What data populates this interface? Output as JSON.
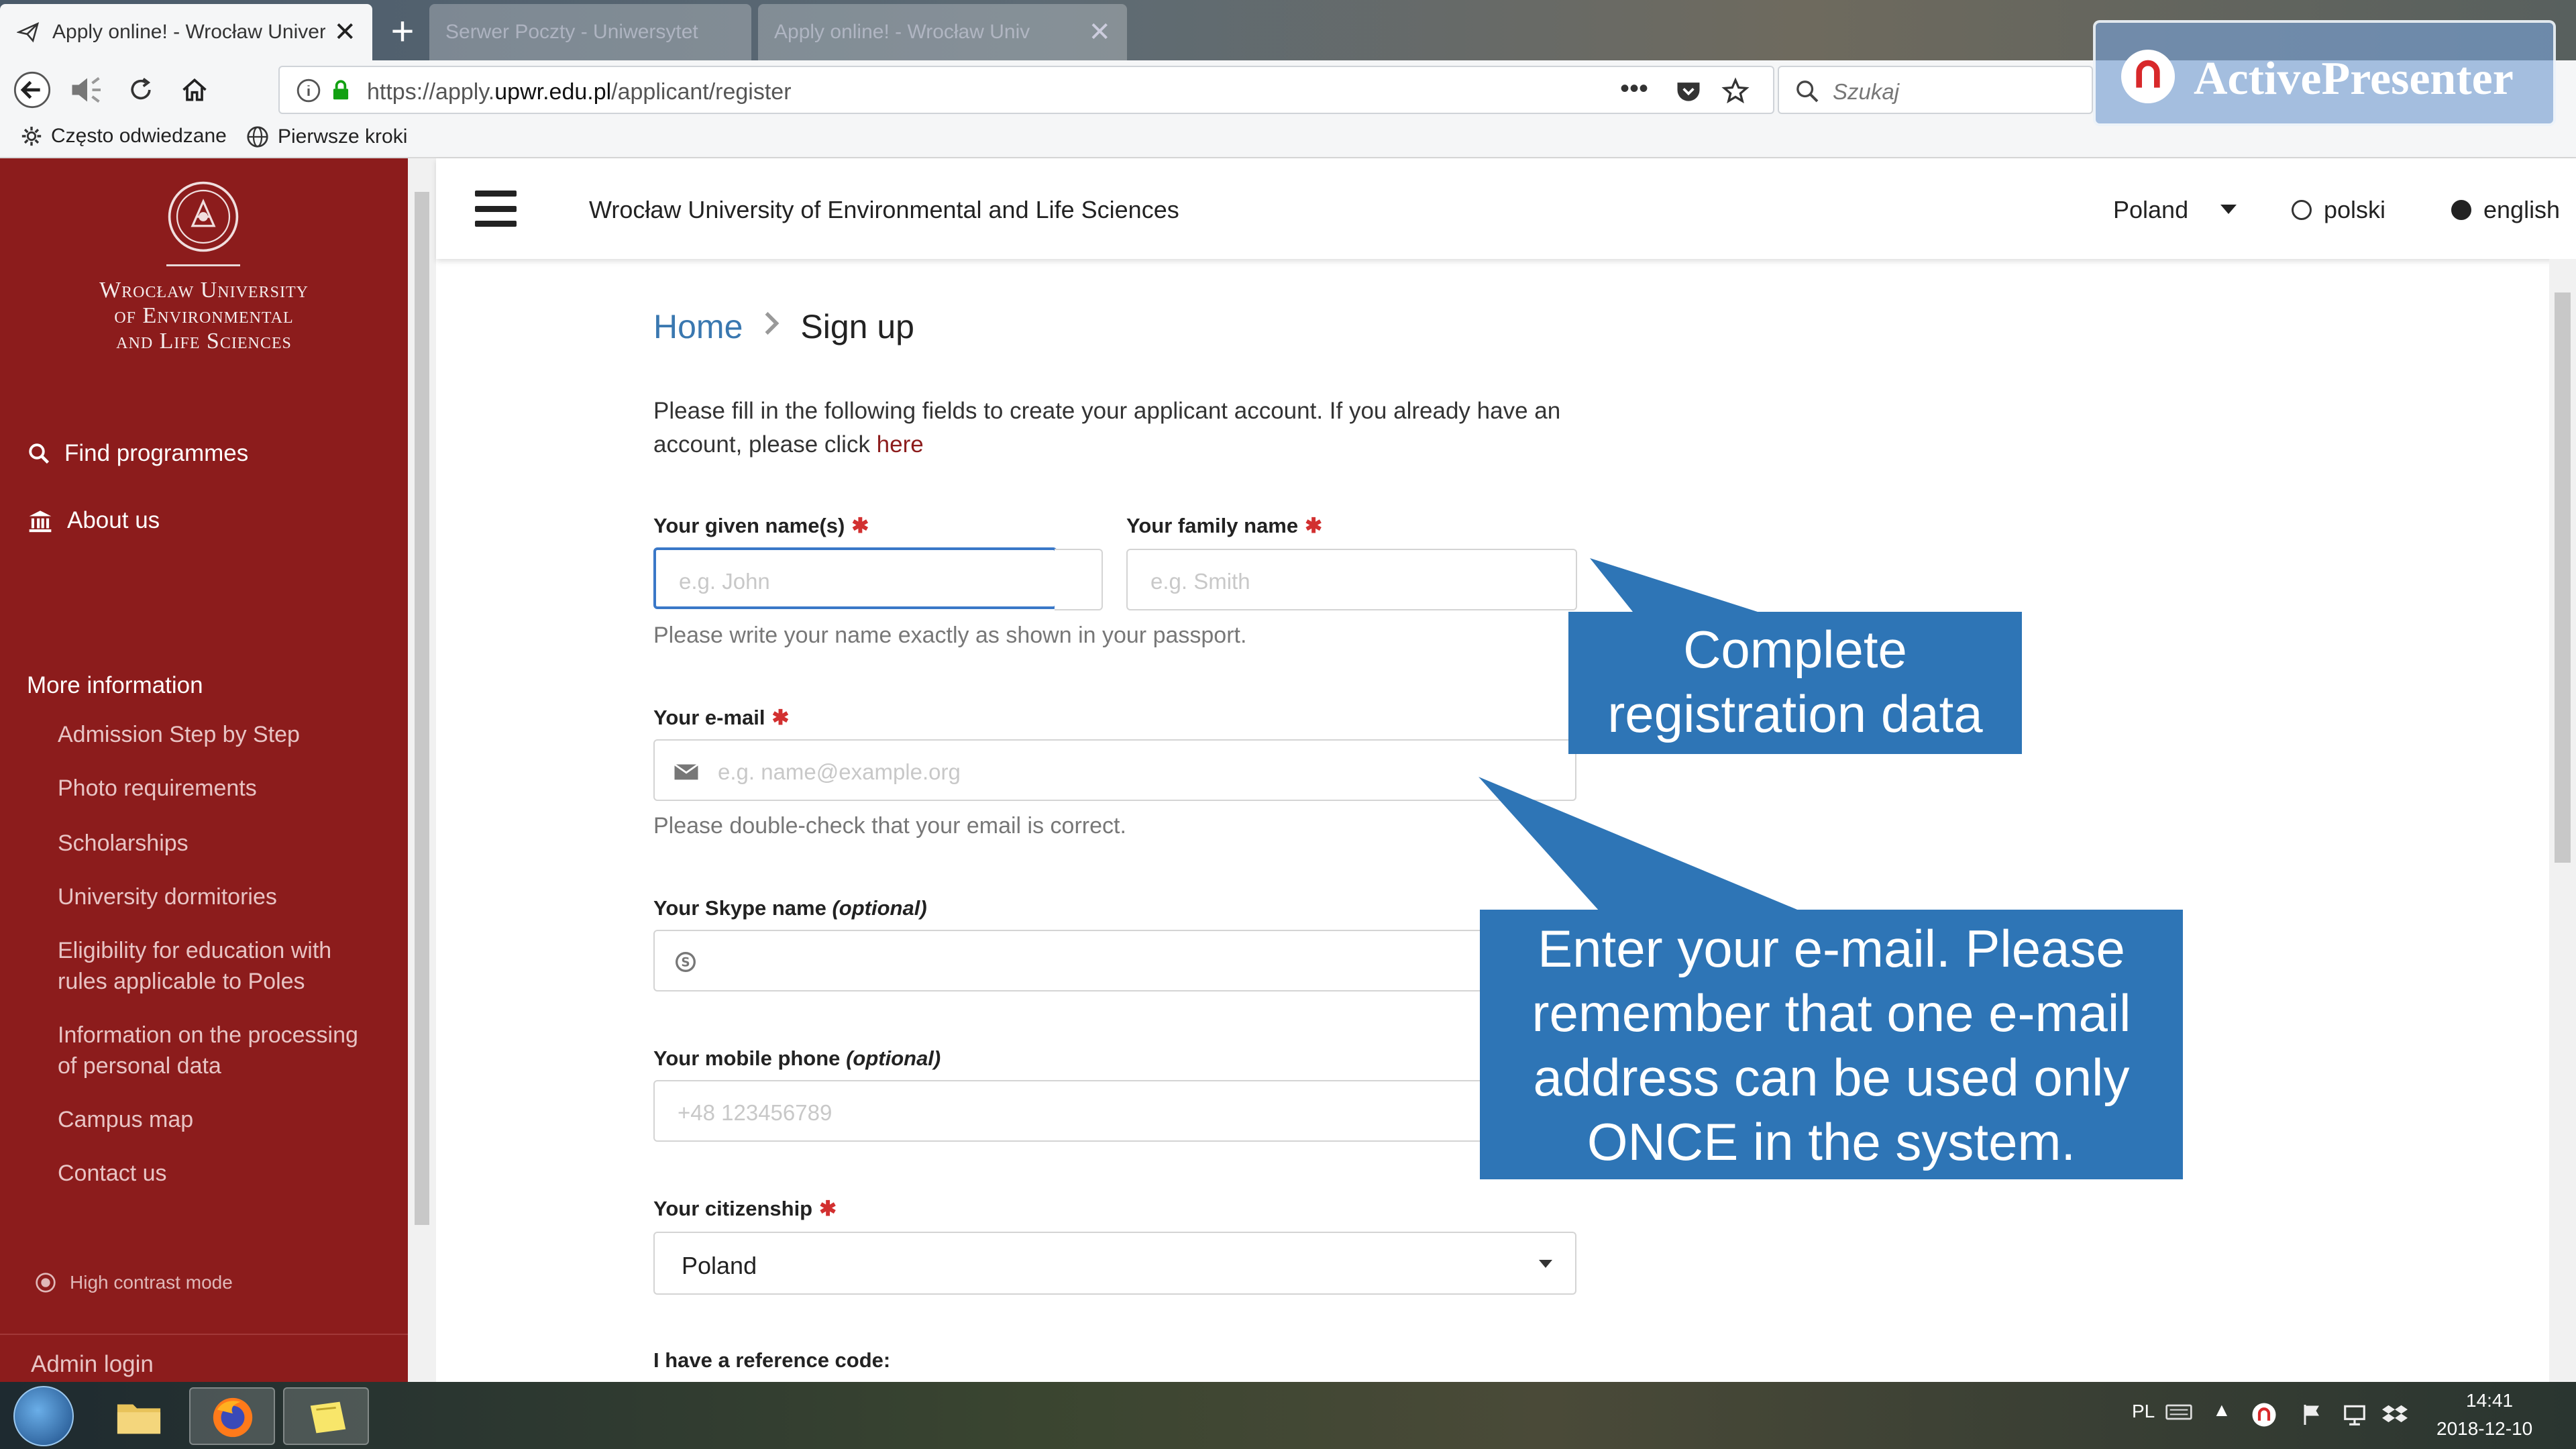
{
  "browser": {
    "active_tab": "Apply online! - Wrocław Univer",
    "inactive_tabs": [
      "Serwer Poczty - Uniwersytet",
      "Apply online! - Wrocław Univ"
    ],
    "url_prefix": "https://apply.",
    "url_host": "upwr.edu.pl",
    "url_path": "/applicant/register",
    "search_placeholder": "Szukaj",
    "bookmarks": [
      "Często odwiedzane",
      "Pierwsze kroki"
    ]
  },
  "watermark": {
    "text": "ActivePresenter"
  },
  "sidebar": {
    "university_name_lines": [
      "Wrocław University",
      "of Environmental",
      "and Life Sciences"
    ],
    "links": [
      {
        "label": "Find programmes",
        "icon": "search-icon"
      },
      {
        "label": "About us",
        "icon": "building-icon"
      }
    ],
    "more_heading": "More information",
    "more_items": [
      "Admission Step by Step",
      "Photo requirements",
      "Scholarships",
      "University dormitories",
      "Eligibility for education with rules applicable to Poles",
      "Information on the processing of personal data",
      "Campus map",
      "Contact us"
    ],
    "contrast_mode": "High contrast mode",
    "admin_login": "Admin login"
  },
  "header": {
    "title": "Wrocław University of Environmental and Life Sciences",
    "country": "Poland",
    "languages": [
      {
        "label": "polski",
        "selected": false
      },
      {
        "label": "english",
        "selected": true
      }
    ]
  },
  "breadcrumb": {
    "home": "Home",
    "current": "Sign up"
  },
  "intro": {
    "text": "Please fill in the following fields to create your applicant account. If you already have an account, please click ",
    "link": "here"
  },
  "form": {
    "given_name": {
      "label": "Your given name(s)",
      "placeholder": "e.g. John"
    },
    "family_name": {
      "label": "Your family name",
      "placeholder": "e.g. Smith"
    },
    "name_hint": "Please write your name exactly as shown in your passport.",
    "email": {
      "label": "Your e-mail",
      "placeholder": "e.g. name@example.org",
      "hint": "Please double-check that your email is correct."
    },
    "skype": {
      "label": "Your Skype name",
      "optional": "(optional)"
    },
    "phone": {
      "label": "Your mobile phone",
      "optional": "(optional)",
      "placeholder": "+48 123456789"
    },
    "citizenship": {
      "label": "Your citizenship",
      "value": "Poland"
    },
    "reference_label": "I have a reference code:"
  },
  "callouts": {
    "complete": [
      "Complete",
      "registration data"
    ],
    "email": [
      "Enter your e-mail. Please",
      "remember that one e-mail",
      "address can be used only",
      "ONCE in the system."
    ]
  },
  "taskbar": {
    "lang": "PL",
    "time": "14:41",
    "date": "2018-12-10"
  },
  "colors": {
    "sidebar": "#8c1c1c",
    "callout": "#2e75b6",
    "link": "#3a78b0",
    "required": "#d23030"
  }
}
